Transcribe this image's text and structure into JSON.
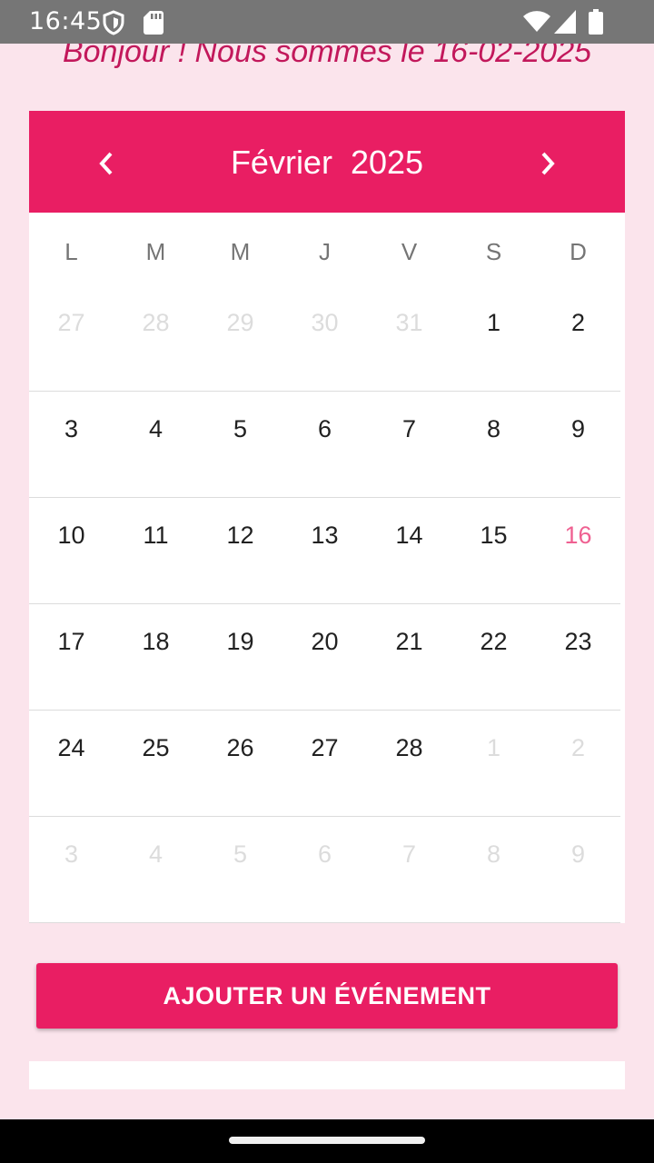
{
  "status_bar": {
    "time": "16:45",
    "icons": [
      "shield-icon",
      "sd-card-icon",
      "wifi-icon",
      "signal-icon",
      "battery-icon"
    ]
  },
  "greeting": "Bonjour ! Nous sommes le 16-02-2025",
  "calendar": {
    "month_label": "Février  2025",
    "header_color": "#e91e63",
    "prev_icon": "chevron-left-icon",
    "next_icon": "chevron-right-icon",
    "weekdays": [
      "L",
      "M",
      "M",
      "J",
      "V",
      "S",
      "D"
    ],
    "weeks": [
      [
        "27",
        "28",
        "29",
        "30",
        "31",
        "1",
        "2"
      ],
      [
        "3",
        "4",
        "5",
        "6",
        "7",
        "8",
        "9"
      ],
      [
        "10",
        "11",
        "12",
        "13",
        "14",
        "15",
        "16"
      ],
      [
        "17",
        "18",
        "19",
        "20",
        "21",
        "22",
        "23"
      ],
      [
        "24",
        "25",
        "26",
        "27",
        "28",
        "1",
        "2"
      ],
      [
        "3",
        "4",
        "5",
        "6",
        "7",
        "8",
        "9"
      ]
    ],
    "today": "16"
  },
  "add_event_button": "AJOUTER UN ÉVÉNEMENT",
  "colors": {
    "accent": "#e91e63",
    "background": "#fbe4ec",
    "greeting": "#c2185b"
  }
}
